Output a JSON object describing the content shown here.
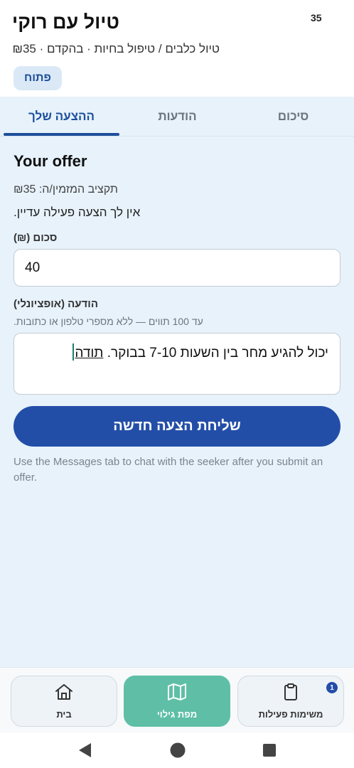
{
  "header": {
    "title": "טיול עם רוקי",
    "count": "35",
    "subtitle": "טיול כלבים / טיפול בחיות · בהקדם · ₪35",
    "status": "פתוח"
  },
  "tabs": [
    {
      "label": "ההצעה שלך",
      "active": true
    },
    {
      "label": "הודעות",
      "active": false
    },
    {
      "label": "סיכום",
      "active": false
    }
  ],
  "offer": {
    "heading": "Your offer",
    "budget": "תקציב המזמין/ה: ₪35",
    "no_active_offer": "אין לך הצעה פעילה עדיין.",
    "amount_label": "סכום (₪)",
    "amount_value": "40",
    "message_label": "הודעה (אופציונלי)",
    "message_hint": "עד 100 תווים — ללא מספרי טלפון או כתובות.",
    "message_text": "יכול להגיע מחר בין השעות 7-10 בבוקר.",
    "message_last_word": "תודה",
    "submit_label": "שליחת הצעה חדשה",
    "footer_note": "Use the Messages tab to chat with the seeker after you submit an offer."
  },
  "bottom_nav": {
    "items": [
      {
        "label": "משימות פעילות",
        "icon": "clipboard-icon",
        "badge": "1"
      },
      {
        "label": "מפת גילוי",
        "icon": "map-icon",
        "active": true
      },
      {
        "label": "בית",
        "icon": "home-icon"
      }
    ]
  },
  "system_nav": {
    "icons": [
      "back-icon",
      "home-circle-icon",
      "recents-icon"
    ]
  },
  "colors": {
    "primary": "#234ea8",
    "accent": "#5ebfa6",
    "background": "#e7f2fb"
  }
}
